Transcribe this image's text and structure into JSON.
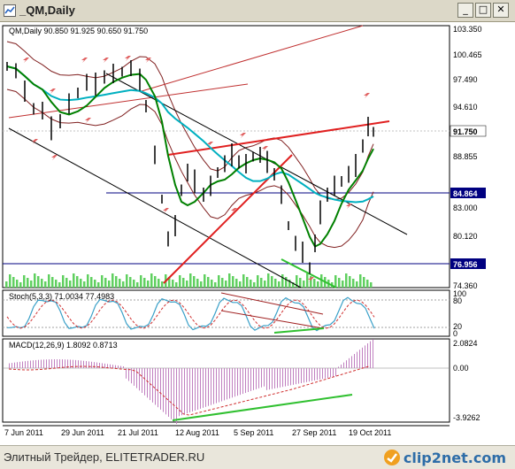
{
  "window": {
    "title": "_QM,Daily",
    "minimize_glyph": "_",
    "restore_glyph": "□",
    "close_glyph": "✕",
    "icon": "chart-window-icon"
  },
  "price_panel": {
    "caption": "QM,Daily  90.850 91.925 90.650 91.750",
    "y_ticks": [
      "103.350",
      "100.465",
      "97.490",
      "94.610",
      "91.750",
      "88.855",
      "84.864",
      "83.000",
      "80.120",
      "76.956",
      "74.360"
    ],
    "current_price": "91.750",
    "hline_1": "84.864",
    "hline_2": "76.956"
  },
  "stoch_panel": {
    "caption": "Stoch(5,3,3) 71.0034 77.4983",
    "y_ticks": [
      "100",
      "80",
      "20",
      "0"
    ]
  },
  "macd_panel": {
    "caption": "MACD(12,26,9) 1.8092 0.8713",
    "y_ticks": [
      "2.0824",
      "0.00",
      "-3.9262"
    ]
  },
  "x_axis": {
    "labels": [
      "7 Jun 2011",
      "29 Jun 2011",
      "21 Jul 2011",
      "12 Aug 2011",
      "5 Sep 2011",
      "27 Sep 2011",
      "19 Oct 2011"
    ]
  },
  "colors": {
    "price_line": "#000000",
    "ma_fast": "#008000",
    "ma_slow": "#00b0c0",
    "bands": "#802020",
    "trend_red": "#e02020",
    "trend_green": "#30c030",
    "fractal": "#e06060",
    "volume": "#60d060",
    "hline": "#000080"
  },
  "footer": {
    "text": "Элитный Трейдер, ELITETRADER.RU",
    "brand": "clip2net.com",
    "brand_icon": "clip2net-logo-icon"
  }
}
